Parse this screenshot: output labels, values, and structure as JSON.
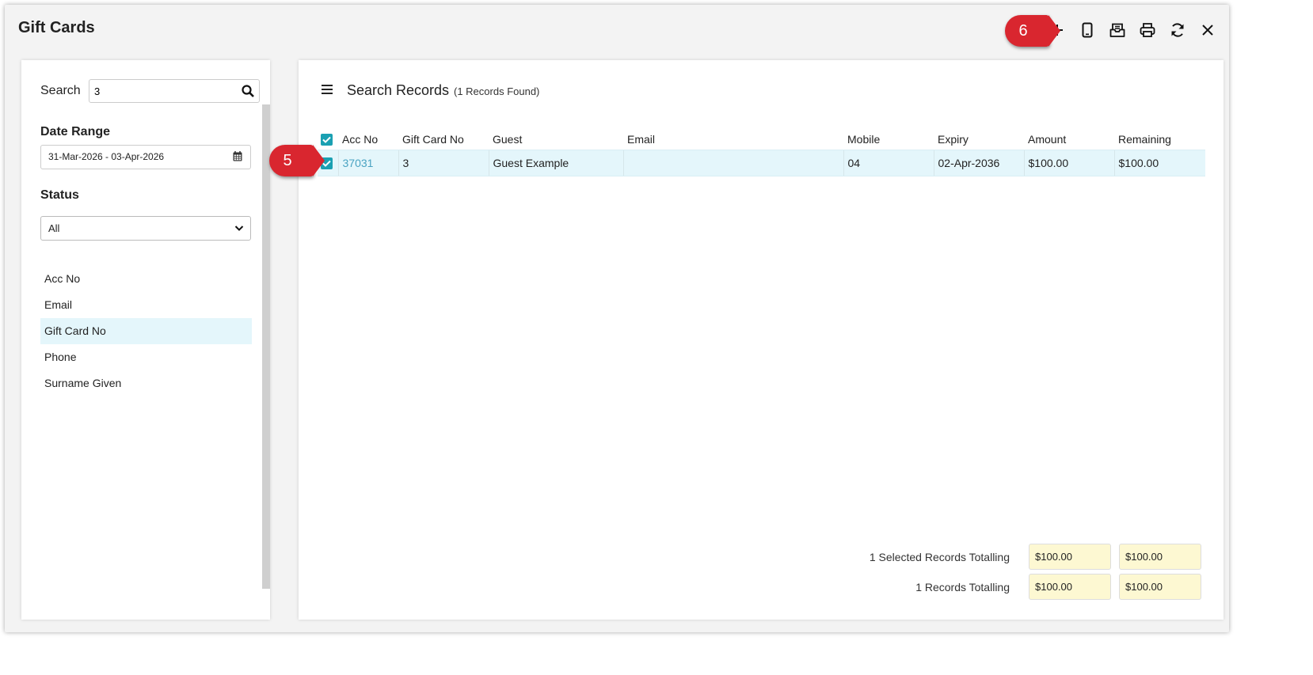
{
  "window": {
    "title": "Gift Cards"
  },
  "toolbar": {
    "icons": [
      "plus-icon",
      "mobile-phone-icon",
      "email-inbox-icon",
      "printer-icon",
      "refresh-icon",
      "close-icon"
    ]
  },
  "callouts": {
    "step_6": "6",
    "step_5": "5"
  },
  "filters": {
    "search_label": "Search",
    "search_value": "3",
    "date_range_label": "Date Range",
    "date_range_value": "31-Mar-2026 - 03-Apr-2026",
    "status_label": "Status",
    "status_value": "All",
    "search_fields": [
      {
        "label": "Acc No"
      },
      {
        "label": "Email"
      },
      {
        "label": "Gift Card No",
        "selected": true
      },
      {
        "label": "Phone"
      },
      {
        "label": "Surname Given"
      }
    ]
  },
  "results": {
    "title": "Search Records",
    "count_text": "(1 Records Found)",
    "columns": [
      "Acc No",
      "Gift Card No",
      "Guest",
      "Email",
      "Mobile",
      "Expiry",
      "Amount",
      "Remaining"
    ],
    "rows": [
      {
        "acc_no": "37031",
        "gift_card_no": "3",
        "guest": "Guest Example",
        "email": "",
        "mobile": "04",
        "expiry": "02-Apr-2036",
        "amount": "$100.00",
        "remaining": "$100.00"
      }
    ]
  },
  "totals": {
    "selected_label": "1 Selected Records Totalling",
    "selected_amount": "$100.00",
    "selected_remaining": "$100.00",
    "all_label": "1 Records Totalling",
    "all_amount": "$100.00",
    "all_remaining": "$100.00"
  },
  "colors": {
    "accent": "#1aa0b2",
    "callout": "#d9262f",
    "row_highlight": "#e4f6fb",
    "totals_bg": "#fdf8d2"
  }
}
